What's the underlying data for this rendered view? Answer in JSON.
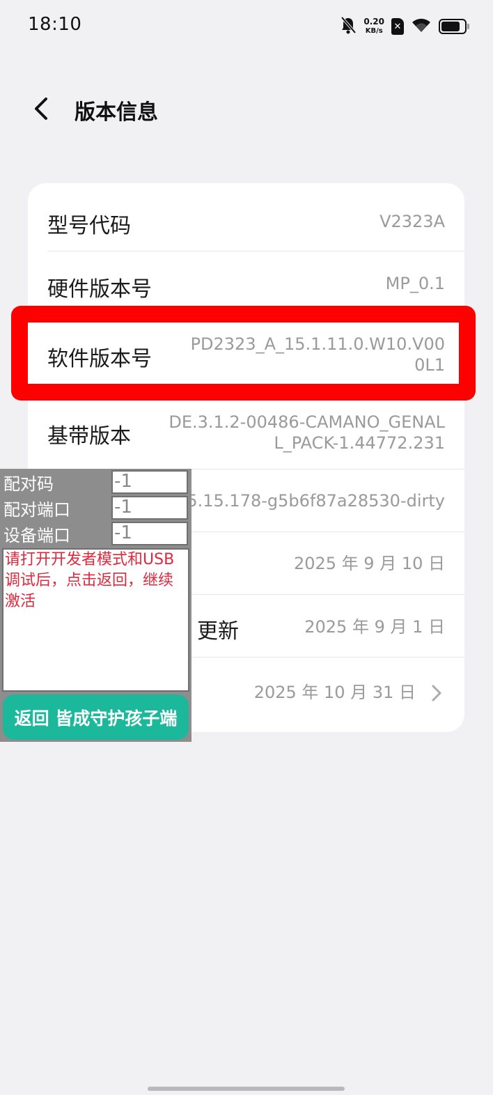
{
  "status_bar": {
    "time": "18:10",
    "speed_value": "0.20",
    "speed_unit": "KB/s",
    "icons": [
      "bell-muted-icon",
      "sim-icon",
      "wifi-icon",
      "battery-icon"
    ]
  },
  "header": {
    "title": "版本信息",
    "back_icon": "chevron-left-icon"
  },
  "info": {
    "model_label": "型号代码",
    "model_value": "V2323A",
    "hardware_label": "硬件版本号",
    "hardware_value": "MP_0.1",
    "software_label": "软件版本号",
    "software_value": "PD2323_A_15.1.11.0.W10.V000L1",
    "baseband_label": "基带版本",
    "baseband_value": "DE.3.1.2-00486-CAMANO_GENALL_PACK-1.44772.231",
    "kernel_value": "5.15.178-g5b6f87a28530-dirty",
    "date1_value": "2025 年 9 月 10 日",
    "update_label_partial": "更新",
    "date2_value": "2025 年 9 月 1 日",
    "date3_value": "2025 年 10 月 31 日"
  },
  "overlay": {
    "pair_code_label": "配对码",
    "pair_code_value": "-1",
    "pair_port_label": "配对端口",
    "pair_port_value": "-1",
    "device_port_label": "设备端口",
    "device_port_value": "-1",
    "message": "请打开开发者模式和USB调试后，点击返回，继续激活",
    "button_label": "返回 皆成守护孩子端"
  },
  "colors": {
    "accent_red": "#ff0000",
    "button_green": "#1bb89c",
    "message_red": "#e0283c"
  }
}
